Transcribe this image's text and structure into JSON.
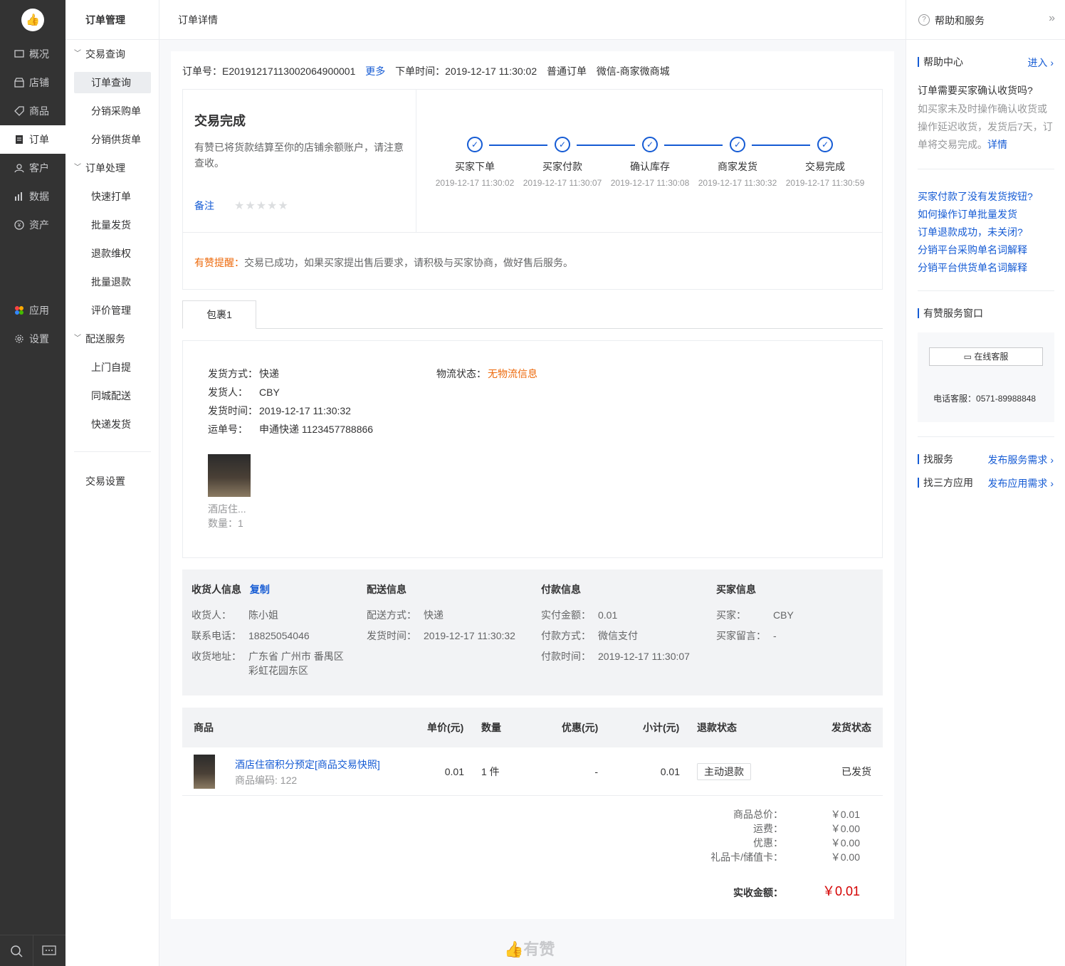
{
  "nav_primary": {
    "items": [
      {
        "label": "概况"
      },
      {
        "label": "店铺"
      },
      {
        "label": "商品"
      },
      {
        "label": "订单"
      },
      {
        "label": "客户"
      },
      {
        "label": "数据"
      },
      {
        "label": "资产"
      },
      {
        "label": "应用"
      },
      {
        "label": "设置"
      }
    ]
  },
  "nav_secondary": {
    "title": "订单管理",
    "groups": [
      {
        "label": "交易查询",
        "items": [
          "订单查询",
          "分销采购单",
          "分销供货单"
        ]
      },
      {
        "label": "订单处理",
        "items": [
          "快速打单",
          "批量发货",
          "退款维权",
          "批量退款",
          "评价管理"
        ]
      },
      {
        "label": "配送服务",
        "items": [
          "上门自提",
          "同城配送",
          "快递发货"
        ]
      }
    ],
    "settings": "交易设置"
  },
  "topbar": {
    "title": "订单详情"
  },
  "order": {
    "number_label": "订单号：",
    "number": "E20191217113002064900001",
    "more": "更多",
    "time_label": "下单时间：",
    "time": "2019-12-17 11:30:02",
    "type": "普通订单",
    "channel": "微信-商家微商城"
  },
  "status": {
    "title": "交易完成",
    "desc": "有赞已将货款结算至你的店铺余额账户，请注意查收。",
    "remark": "备注",
    "stars": "★★★★★",
    "steps": [
      {
        "label": "买家下单",
        "time": "2019-12-17 11:30:02"
      },
      {
        "label": "买家付款",
        "time": "2019-12-17 11:30:07"
      },
      {
        "label": "确认库存",
        "time": "2019-12-17 11:30:08"
      },
      {
        "label": "商家发货",
        "time": "2019-12-17 11:30:32"
      },
      {
        "label": "交易完成",
        "time": "2019-12-17 11:30:59"
      }
    ],
    "tip_label": "有赞提醒：",
    "tip_text": "交易已成功，如果买家提出售后要求，请积极与买家协商，做好售后服务。"
  },
  "package": {
    "tab": "包裹1",
    "method_label": "发货方式：",
    "method": "快递",
    "sender_label": "发货人：",
    "sender": "CBY",
    "ship_time_label": "发货时间：",
    "ship_time": "2019-12-17 11:30:32",
    "waybill_label": "运单号：",
    "waybill": "申通快递 1123457788866",
    "logistics_label": "物流状态：",
    "logistics": "无物流信息",
    "product_name": "酒店住...",
    "product_qty": "数量：1"
  },
  "info": {
    "receiver": {
      "title": "收货人信息",
      "copy": "复制",
      "name_label": "收货人：",
      "name": "陈小姐",
      "phone_label": "联系电话：",
      "phone": "18825054046",
      "addr_label": "收货地址：",
      "addr1": "广东省 广州市 番禺区",
      "addr2": "彩虹花园东区"
    },
    "delivery": {
      "title": "配送信息",
      "method_label": "配送方式：",
      "method": "快递",
      "time_label": "发货时间：",
      "time": "2019-12-17 11:30:32"
    },
    "payment": {
      "title": "付款信息",
      "amount_label": "实付金额：",
      "amount": "0.01",
      "method_label": "付款方式：",
      "method": "微信支付",
      "time_label": "付款时间：",
      "time": "2019-12-17 11:30:07"
    },
    "buyer": {
      "title": "买家信息",
      "name_label": "买家：",
      "name": "CBY",
      "msg_label": "买家留言：",
      "msg": "-"
    }
  },
  "table": {
    "headers": [
      "商品",
      "单价(元)",
      "数量",
      "优惠(元)",
      "小计(元)",
      "退款状态",
      "发货状态"
    ],
    "row": {
      "title": "酒店住宿积分预定[商品交易快照]",
      "code": "商品编码: 122",
      "price": "0.01",
      "qty": "1 件",
      "discount": "-",
      "subtotal": "0.01",
      "refund": "主动退款",
      "ship": "已发货"
    }
  },
  "totals": {
    "items": [
      {
        "label": "商品总价：",
        "value": "￥0.01"
      },
      {
        "label": "运费：",
        "value": "￥0.00"
      },
      {
        "label": "优惠：",
        "value": "￥0.00"
      },
      {
        "label": "礼品卡/储值卡：",
        "value": "￥0.00"
      }
    ],
    "final_label": "实收金额：",
    "final_value": "￥0.01"
  },
  "footer": {
    "brand": "有赞"
  },
  "right_panel": {
    "title": "帮助和服务",
    "help_center": "帮助中心",
    "enter": "进入",
    "faq_q": "订单需要买家确认收货吗?",
    "faq_a": "如买家未及时操作确认收货或操作延迟收货，发货后7天，订单将交易完成。",
    "faq_more": "详情",
    "links": [
      "买家付款了没有发货按钮?",
      "如何操作订单批量发货",
      "订单退款成功，未关闭?",
      "分销平台采购单名词解释",
      "分销平台供货单名词解释"
    ],
    "service_window": "有赞服务窗口",
    "online_service": "在线客服",
    "phone_label": "电话客服：",
    "phone": "0571-89988848",
    "find_service": "找服务",
    "publish_service": "发布服务需求",
    "find_app": "找三方应用",
    "publish_app": "发布应用需求"
  }
}
